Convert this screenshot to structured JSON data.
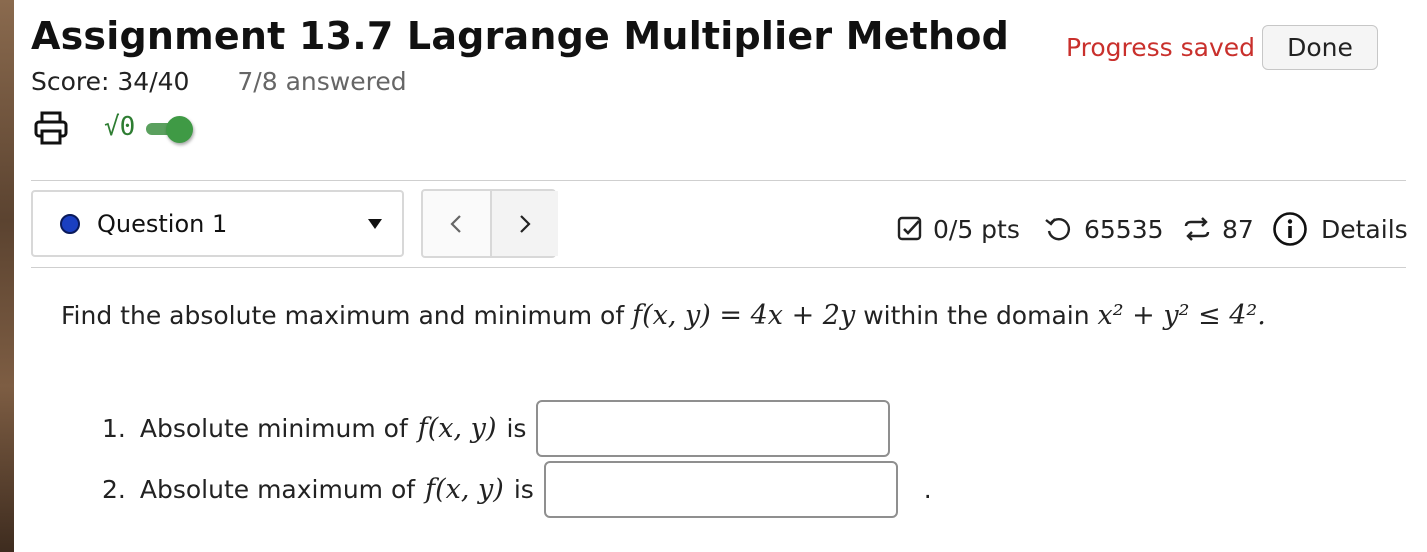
{
  "assignment": {
    "title": "Assignment 13.7 Lagrange Multiplier Method",
    "score": "Score: 34/40",
    "answered": "7/8 answered"
  },
  "header": {
    "status": "Progress saved",
    "done_label": "Done",
    "status_color": "#c9302c"
  },
  "toolbar": {
    "print_icon": "print-icon",
    "math_toggle_label": "√0",
    "math_toggle_on": true
  },
  "question_nav": {
    "selected": "Question 1",
    "prev_label": "<",
    "next_label": ">"
  },
  "question_meta": {
    "points": "0/5 pts",
    "attempts": "65535",
    "retakes": "87",
    "details_label": "Details"
  },
  "question": {
    "prompt_prefix": "Find the absolute maximum and minimum of",
    "function": "f(x, y) = 4x + 2y",
    "prompt_middle": "within the domain",
    "domain": "x² + y² ≤ 4².",
    "parts": [
      {
        "number": "1.",
        "label_prefix": "Absolute minimum of",
        "fn": "f(x, y)",
        "label_suffix": "is",
        "value": ""
      },
      {
        "number": "2.",
        "label_prefix": "Absolute maximum of",
        "fn": "f(x, y)",
        "label_suffix": "is",
        "value": ""
      }
    ],
    "trailing": "."
  }
}
